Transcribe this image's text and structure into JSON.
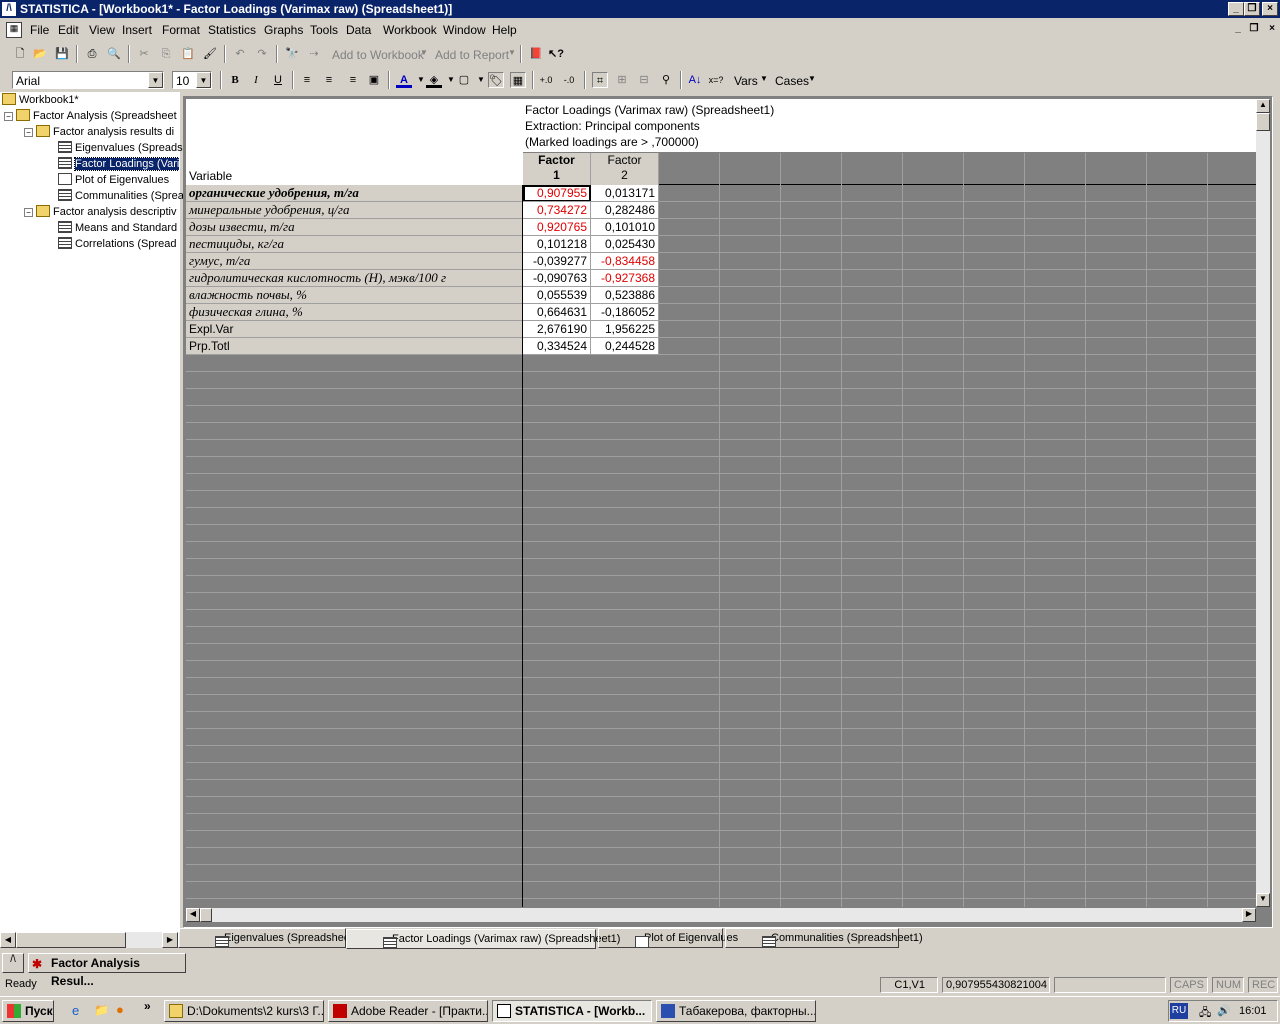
{
  "title_bar": {
    "title": "STATISTICA - [Workbook1* - Factor Loadings (Varimax raw) (Spreadsheet1)]"
  },
  "menu": [
    "File",
    "Edit",
    "View",
    "Insert",
    "Format",
    "Statistics",
    "Graphs",
    "Tools",
    "Data",
    "Workbook",
    "Window",
    "Help"
  ],
  "toolbar": {
    "add_to_workbook": "Add to Workbook",
    "add_to_report": "Add to Report",
    "font_name": "Arial",
    "font_size": "10",
    "vars_label": "Vars",
    "cases_label": "Cases",
    "bold": "B",
    "italic": "I",
    "underline": "U"
  },
  "tree": {
    "root": "Workbook1*",
    "group1": "Factor Analysis (Spreadsheet",
    "sub1": "Factor analysis results di",
    "items1": [
      "Eigenvalues (Spreads",
      "Factor Loadings (Vari",
      "Plot of Eigenvalues",
      "Communalities (Sprea"
    ],
    "sub2": "Factor analysis descriptiv",
    "items2": [
      "Means and Standard",
      "Correlations (Spread"
    ]
  },
  "spreadsheet": {
    "header_lines": [
      "Factor Loadings (Varimax raw) (Spreadsheet1)",
      "Extraction: Principal components",
      "(Marked loadings are > ,700000)"
    ],
    "variable_label": "Variable",
    "columns": [
      {
        "line1": "Factor",
        "line2": "1"
      },
      {
        "line1": "Factor",
        "line2": "2"
      }
    ],
    "rows": [
      {
        "label": "органические удобрения, т/га",
        "f1": "0,907955",
        "f2": "0,013171",
        "f1_marked": true,
        "f2_marked": false
      },
      {
        "label": "минеральные удобрения, ц/га",
        "f1": "0,734272",
        "f2": "0,282486",
        "f1_marked": true,
        "f2_marked": false
      },
      {
        "label": "дозы извести, т/га",
        "f1": "0,920765",
        "f2": "0,101010",
        "f1_marked": true,
        "f2_marked": false
      },
      {
        "label": "пестициды, кг/га",
        "f1": "0,101218",
        "f2": "0,025430",
        "f1_marked": false,
        "f2_marked": false
      },
      {
        "label": "гумус, т/га",
        "f1": "-0,039277",
        "f2": "-0,834458",
        "f1_marked": false,
        "f2_marked": true
      },
      {
        "label": "гидролитическая кислотность (Н), мэкв/100 г",
        "f1": "-0,090763",
        "f2": "-0,927368",
        "f1_marked": false,
        "f2_marked": true
      },
      {
        "label": "влажность почвы, %",
        "f1": "0,055539",
        "f2": "0,523886",
        "f1_marked": false,
        "f2_marked": false
      },
      {
        "label": "физическая глина, %",
        "f1": "0,664631",
        "f2": "-0,186052",
        "f1_marked": false,
        "f2_marked": false
      }
    ],
    "summary_rows": [
      {
        "label": "Expl.Var",
        "f1": "2,676190",
        "f2": "1,956225"
      },
      {
        "label": "Prp.Totl",
        "f1": "0,334524",
        "f2": "0,244528"
      }
    ]
  },
  "tabs": [
    "Eigenvalues (Spreadsheet1)",
    "Factor Loadings (Varimax raw) (Spreadsheet1)",
    "Plot of Eigenvalues",
    "Communalities (Spreadsheet1)"
  ],
  "minimized_window": "Factor Analysis Resul...",
  "status": {
    "ready": "Ready",
    "cell": "C1,V1",
    "value": "0,907955430821004",
    "caps": "CAPS",
    "num": "NUM",
    "rec": "REC"
  },
  "taskbar": {
    "start": "Пуск",
    "buttons": [
      "D:\\Dokuments\\2 kurs\\3 Г...",
      "Adobe Reader - [Практи...",
      "STATISTICA - [Workb...",
      "Табакерова, факторны..."
    ],
    "lang": "RU",
    "time": "16:01"
  },
  "colors": {
    "title_bg": "#0a246a",
    "marked": "#e00000",
    "grid_bg": "#808080",
    "face": "#d4d0c8"
  }
}
